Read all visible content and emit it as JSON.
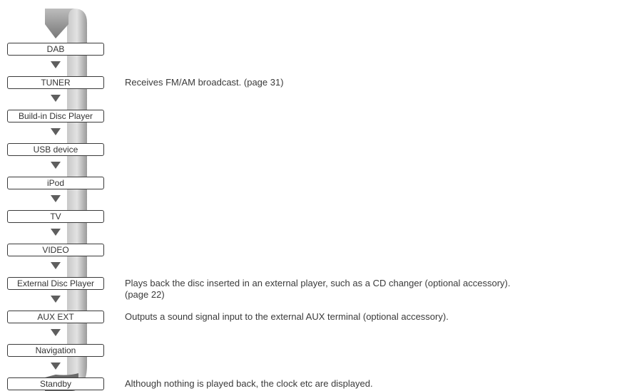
{
  "sources": [
    {
      "label": "DAB",
      "description": ""
    },
    {
      "label": "TUNER",
      "description": "Receives FM/AM broadcast. (page 31)"
    },
    {
      "label": "Build-in Disc Player",
      "description": ""
    },
    {
      "label": "USB device",
      "description": ""
    },
    {
      "label": "iPod",
      "description": ""
    },
    {
      "label": "TV",
      "description": ""
    },
    {
      "label": "VIDEO",
      "description": ""
    },
    {
      "label": "External Disc Player",
      "description": "Plays back the disc inserted in an external player, such as a CD changer (optional accessory).\n(page 22)"
    },
    {
      "label": "AUX EXT",
      "description": "Outputs a sound signal input to the external AUX terminal (optional accessory)."
    },
    {
      "label": "Navigation",
      "description": ""
    },
    {
      "label": "Standby",
      "description": "Although nothing is played back, the clock etc are displayed."
    }
  ],
  "colors": {
    "loop_band": "#c8c8c8",
    "loop_band_dark": "#9a9a9a",
    "start_arrow": "#777777",
    "end_arrow": "#6a6a6a",
    "step_arrow": "#5e5e5e",
    "box_border": "#3a3a3a",
    "text": "#333333"
  }
}
